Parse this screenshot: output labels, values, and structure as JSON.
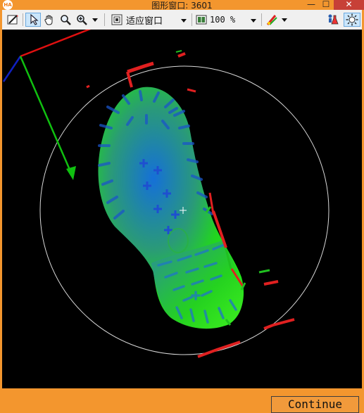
{
  "window": {
    "logo": "HA",
    "title": "图形窗口: 3601",
    "minimize_glyph": "—",
    "maximize_glyph": "☐",
    "close_glyph": "✕"
  },
  "toolbar": {
    "fit_window_label": "适应窗口",
    "zoom_value": "100 %"
  },
  "canvas": {
    "continue_label": "Continue"
  },
  "colors": {
    "accent_orange": "#f3962e",
    "canvas_background": "#000000",
    "axis_x": "#e01010",
    "axis_y": "#10c010",
    "axis_z": "#1020c0"
  },
  "icons": [
    "edit-icon",
    "pointer-icon",
    "hand-pan-icon",
    "zoom-icon",
    "zoom-in-icon",
    "fit-window-icon",
    "zoom-percent-icon",
    "color-settings-icon",
    "flask-person-icon",
    "light-settings-icon"
  ]
}
